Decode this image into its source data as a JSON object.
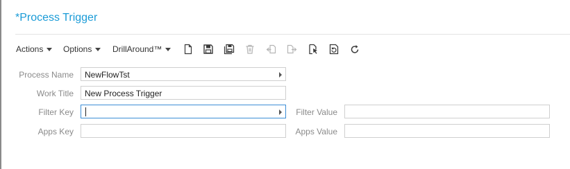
{
  "page": {
    "title": "*Process Trigger"
  },
  "toolbar": {
    "actions_label": "Actions",
    "options_label": "Options",
    "drillaround_label": "DrillAround™",
    "icons": [
      {
        "name": "new-document-icon",
        "enabled": true
      },
      {
        "name": "save-icon",
        "enabled": true
      },
      {
        "name": "save-all-icon",
        "enabled": true
      },
      {
        "name": "delete-icon",
        "enabled": false
      },
      {
        "name": "import-icon",
        "enabled": false
      },
      {
        "name": "export-icon",
        "enabled": false
      },
      {
        "name": "select-document-icon",
        "enabled": true
      },
      {
        "name": "refresh-document-icon",
        "enabled": true
      },
      {
        "name": "reload-icon",
        "enabled": true
      }
    ],
    "colors": {
      "enabled": "#3a3a3a",
      "disabled": "#b5b5b5"
    }
  },
  "form": {
    "process_name": {
      "label": "Process Name",
      "value": "NewFlowTst"
    },
    "work_title": {
      "label": "Work Title",
      "value": "New Process Trigger"
    },
    "filter_key": {
      "label": "Filter Key",
      "value": ""
    },
    "filter_value": {
      "label": "Filter Value",
      "value": ""
    },
    "apps_key": {
      "label": "Apps Key",
      "value": ""
    },
    "apps_value": {
      "label": "Apps Value",
      "value": ""
    }
  },
  "colors": {
    "accent": "#1a9bd7",
    "focus_border": "#3b8dd6",
    "field_border": "#cfcfcf",
    "label": "#8a8a8a"
  }
}
